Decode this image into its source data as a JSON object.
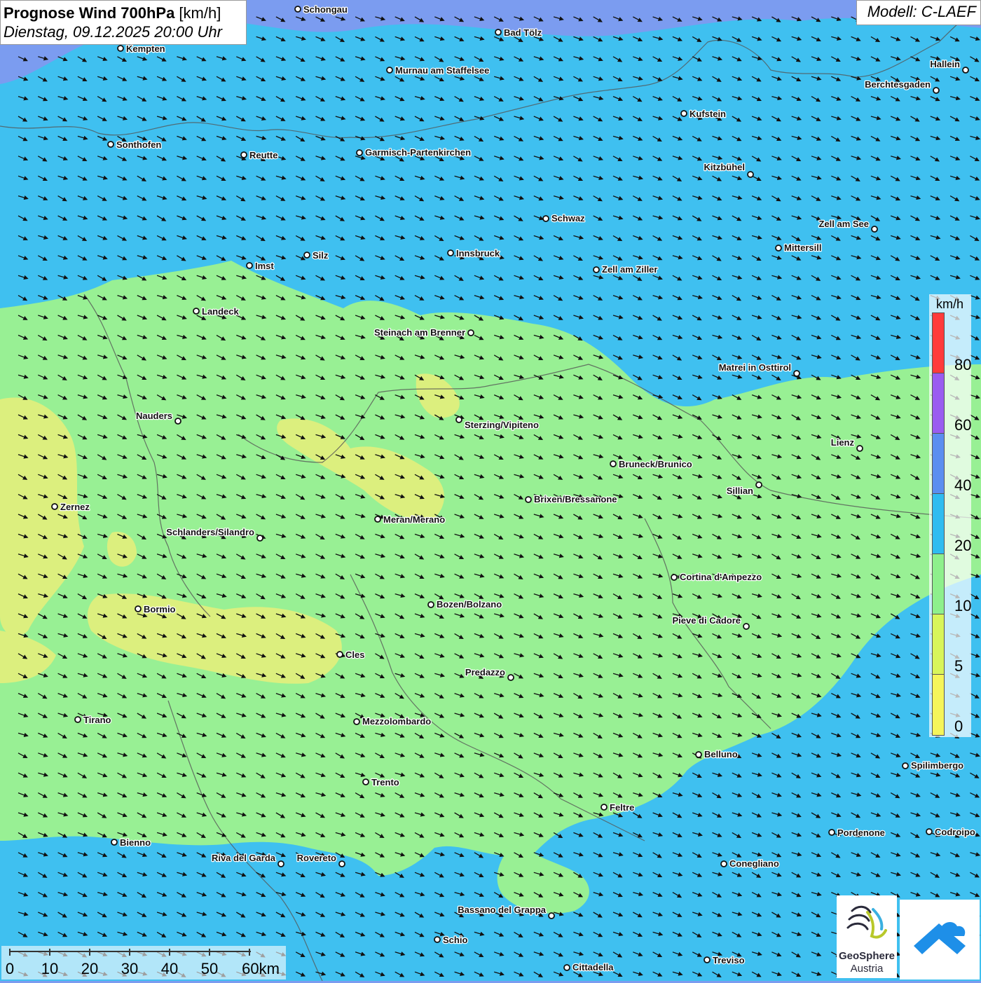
{
  "title": {
    "bold": "Prognose Wind 700hPa",
    "unit": " [km/h]",
    "datetime": "Dienstag, 09.12.2025 20:00 Uhr"
  },
  "model": "Modell: C-LAEF",
  "legend": {
    "unit": "km/h",
    "ticks": [
      "80",
      "60",
      "40",
      "20",
      "10",
      "5",
      "0"
    ],
    "colors": [
      "#ff3b3b",
      "#9a5cf0",
      "#5b8ef0",
      "#2fbcf0",
      "#8ef08c",
      "#d8f55a",
      "#f5f55a"
    ]
  },
  "scale_bar": {
    "labels": [
      "0",
      "10",
      "20",
      "30",
      "40",
      "50",
      "60km"
    ]
  },
  "logo": {
    "name": "GeoSphere",
    "sub": "Austria"
  },
  "field_colors": {
    "blue_high": "#7b9cf0",
    "blue": "#3fc0f0",
    "green": "#98f094",
    "yellow": "#dcef7e"
  },
  "wind_direction": "west-northwest (arrows pointing east-southeast)",
  "cities": [
    {
      "name": "Schongau"
    },
    {
      "name": "Bad Tölz"
    },
    {
      "name": "Kempten"
    },
    {
      "name": "Murnau am Staffelsee"
    },
    {
      "name": "Hallein"
    },
    {
      "name": "Berchtesgaden"
    },
    {
      "name": "Kufstein"
    },
    {
      "name": "Sonthofen"
    },
    {
      "name": "Reutte"
    },
    {
      "name": "Garmisch-Partenkirchen"
    },
    {
      "name": "Kitzbühel"
    },
    {
      "name": "Schwaz"
    },
    {
      "name": "Zell am See"
    },
    {
      "name": "Mittersill"
    },
    {
      "name": "Innsbruck"
    },
    {
      "name": "Silz"
    },
    {
      "name": "Imst"
    },
    {
      "name": "Zell am Ziller"
    },
    {
      "name": "Landeck"
    },
    {
      "name": "Steinach am Brenner"
    },
    {
      "name": "Matrei in Osttirol"
    },
    {
      "name": "Nauders"
    },
    {
      "name": "Sterzing/Vipiteno"
    },
    {
      "name": "Lienz"
    },
    {
      "name": "Bruneck/Brunico"
    },
    {
      "name": "Sillian"
    },
    {
      "name": "Zernez"
    },
    {
      "name": "Brixen/Bressanone"
    },
    {
      "name": "Meran/Merano"
    },
    {
      "name": "Schlanders/Silandro"
    },
    {
      "name": "Cortina d'Ampezzo"
    },
    {
      "name": "Bozen/Bolzano"
    },
    {
      "name": "Bormio"
    },
    {
      "name": "Pieve di Cadore"
    },
    {
      "name": "Cles"
    },
    {
      "name": "Predazzo"
    },
    {
      "name": "Tirano"
    },
    {
      "name": "Mezzolombardo"
    },
    {
      "name": "Belluno"
    },
    {
      "name": "Spilimbergo"
    },
    {
      "name": "Trento"
    },
    {
      "name": "Feltre"
    },
    {
      "name": "Bienno"
    },
    {
      "name": "Pordenone"
    },
    {
      "name": "Codroipo"
    },
    {
      "name": "Riva del Garda"
    },
    {
      "name": "Rovereto"
    },
    {
      "name": "Conegliano"
    },
    {
      "name": "Bassano del Grappa"
    },
    {
      "name": "Schio"
    },
    {
      "name": "Treviso"
    },
    {
      "name": "Cittadella"
    }
  ]
}
